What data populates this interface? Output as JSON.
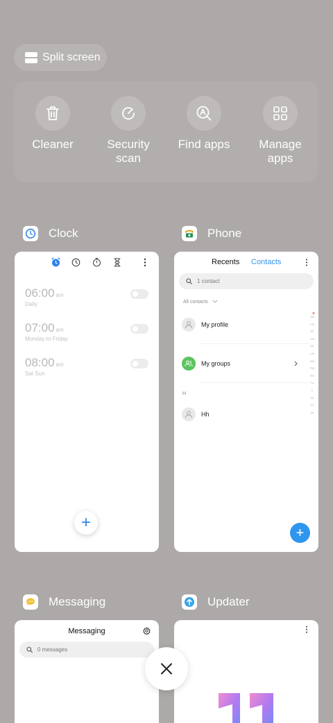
{
  "split_screen": {
    "label": "Split screen"
  },
  "quick_actions": [
    {
      "label": "Cleaner",
      "icon": "trash-icon"
    },
    {
      "label": "Security\nscan",
      "icon": "security-scan-icon"
    },
    {
      "label": "Find apps",
      "icon": "find-apps-icon"
    },
    {
      "label": "Manage\napps",
      "icon": "grid-icon"
    }
  ],
  "apps": {
    "clock": {
      "name": "Clock",
      "alarms": [
        {
          "time": "06:00",
          "ampm": "am",
          "repeat": "Daily"
        },
        {
          "time": "07:00",
          "ampm": "am",
          "repeat": "Monday to Friday"
        },
        {
          "time": "08:00",
          "ampm": "am",
          "repeat": "Sat Sun"
        }
      ],
      "fab": "+"
    },
    "phone": {
      "name": "Phone",
      "tabs": [
        "Recents",
        "Contacts"
      ],
      "search_placeholder": "1 contact",
      "filter": "All contacts",
      "rows": [
        "My profile",
        "My groups",
        "Hh"
      ],
      "section": "H",
      "alphabet": "ABCDEFGHIJKLMNOPQRSTUVWXYZ#",
      "fab": "+"
    },
    "messaging": {
      "name": "Messaging",
      "title": "Messaging",
      "search_placeholder": "0 messages"
    },
    "updater": {
      "name": "Updater"
    }
  },
  "colors": {
    "accent_blue": "#2f96ee",
    "background": "#ada9a8"
  }
}
